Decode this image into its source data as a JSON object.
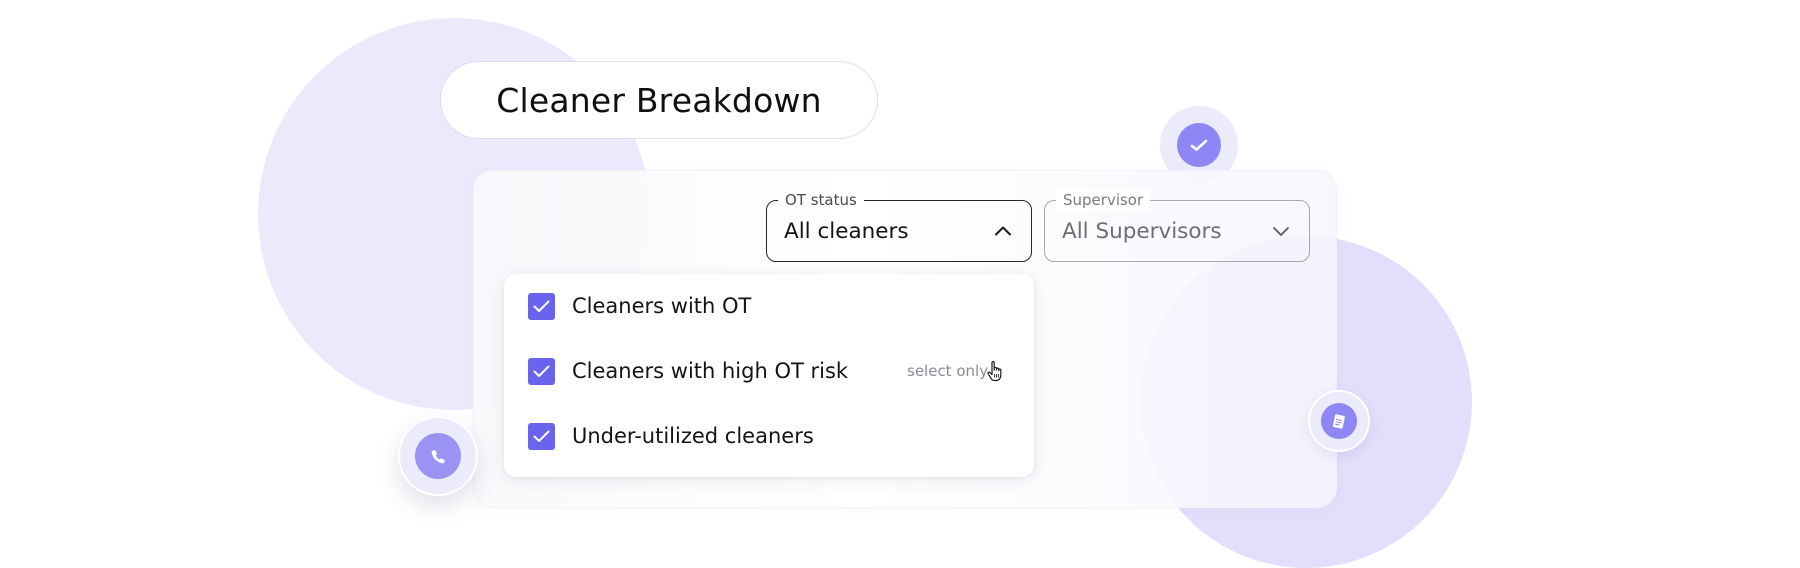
{
  "header": {
    "title": "Cleaner Breakdown"
  },
  "filters": {
    "ot_status": {
      "label": "OT status",
      "value": "All cleaners",
      "expanded": true
    },
    "supervisor": {
      "label": "Supervisor",
      "value": "All Supervisors",
      "expanded": false
    }
  },
  "menu": {
    "items": [
      {
        "label": "Cleaners with OT",
        "checked": true
      },
      {
        "label": "Cleaners with high OT risk",
        "checked": true,
        "hint": "select only"
      },
      {
        "label": "Under-utilized cleaners",
        "checked": true
      }
    ]
  },
  "icons": {
    "float_top": "checkmark-icon",
    "float_left": "phone-icon",
    "float_right": "clipboard-icon",
    "cursor": "pointer-hand-icon"
  },
  "colors": {
    "accent": "#6a63ee",
    "accent_soft": "#8e86f4",
    "blob_light": "#ebeafd",
    "blob_mid": "#e1dffb"
  }
}
